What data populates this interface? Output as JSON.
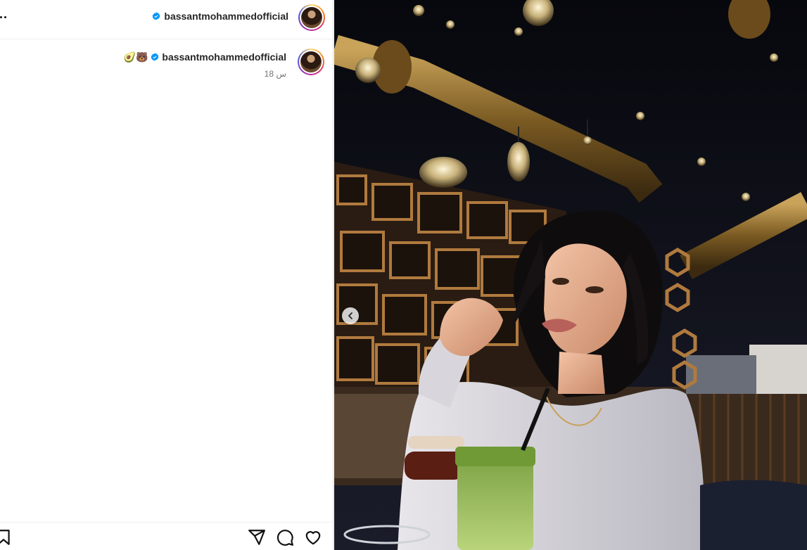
{
  "post": {
    "header_username": "bassantmohammedofficial",
    "caption_username": "bassantmohammedofficial",
    "caption_emojis": "🥑🐻",
    "time_ago": "18 س"
  },
  "icons": {
    "more": "more-options-icon",
    "verified": "verified-badge-icon",
    "like": "heart-icon",
    "comment": "comment-icon",
    "share": "share-icon",
    "save": "bookmark-icon",
    "prev": "chevron-left-icon"
  },
  "colors": {
    "verified": "#0095f6",
    "text": "#262626",
    "muted": "#737373",
    "border": "#dbdbdb"
  },
  "media": {
    "description_icon": "post-photo"
  }
}
